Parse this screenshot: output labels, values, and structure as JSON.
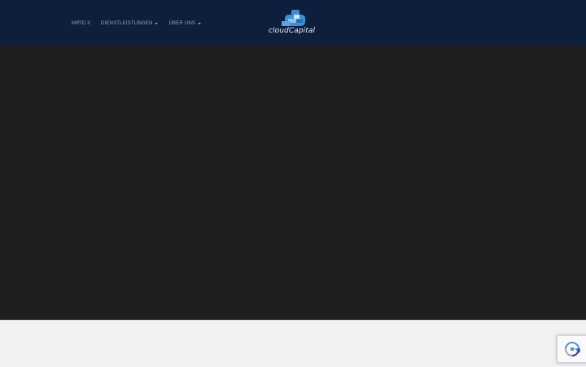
{
  "nav": {
    "items": [
      {
        "label": "MIFID II",
        "has_dropdown": false
      },
      {
        "label": "DIENSTLEISTUNGEN",
        "has_dropdown": true
      },
      {
        "label": "ÜBER UNS",
        "has_dropdown": true
      }
    ]
  },
  "logo": {
    "text": "cloudCapital",
    "icon": "cloud-capital-logo-icon"
  },
  "recaptcha": {
    "icon": "recaptcha-icon"
  },
  "colors": {
    "navbar": "#0d1f3c",
    "hero": "#1f1f1f",
    "footer": "#f2f2f2",
    "nav_text": "#9aa6bd",
    "logo_blue": "#3b8fd6",
    "logo_light": "#8fc3ee"
  }
}
